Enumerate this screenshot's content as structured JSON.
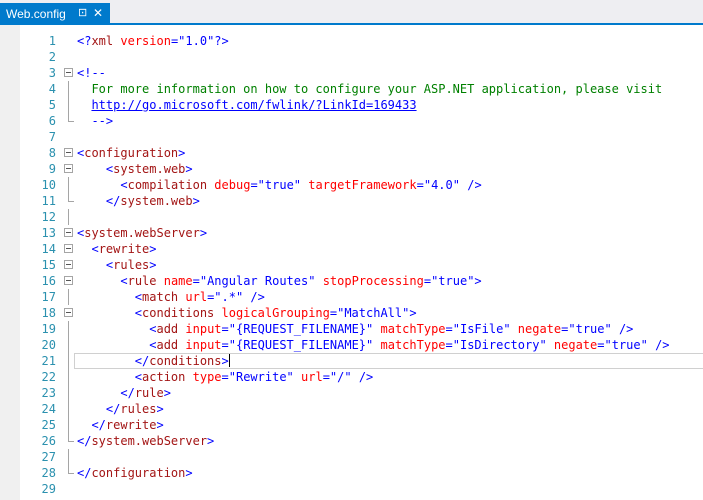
{
  "tab": {
    "title": "Web.config",
    "pin_glyph": "⊡",
    "close_glyph": "✕"
  },
  "editor": {
    "lines": [
      {
        "n": "1",
        "tokens": [
          [
            "b",
            "<?"
          ],
          [
            "t",
            "xml"
          ],
          [
            "a",
            " version"
          ],
          [
            "b",
            "=\""
          ],
          [
            "b",
            "1.0"
          ],
          [
            "b",
            "\"?>"
          ]
        ]
      },
      {
        "n": "2",
        "tokens": []
      },
      {
        "n": "3",
        "tokens": [
          [
            "b",
            "<!--"
          ]
        ]
      },
      {
        "n": "4",
        "tokens": [
          [
            "c",
            "  For more information on how to configure your ASP.NET application, please visit"
          ]
        ]
      },
      {
        "n": "5",
        "tokens": [
          [
            "c",
            "  "
          ],
          [
            "u",
            "http://go.microsoft.com/fwlink/?LinkId=169433"
          ]
        ]
      },
      {
        "n": "6",
        "tokens": [
          [
            "c",
            "  "
          ],
          [
            "b",
            "-->"
          ]
        ]
      },
      {
        "n": "7",
        "tokens": []
      },
      {
        "n": "8",
        "tokens": [
          [
            "b",
            "<"
          ],
          [
            "t",
            "configuration"
          ],
          [
            "b",
            ">"
          ]
        ]
      },
      {
        "n": "9",
        "tokens": [
          [
            "k",
            "    "
          ],
          [
            "b",
            "<"
          ],
          [
            "t",
            "system.web"
          ],
          [
            "b",
            ">"
          ]
        ]
      },
      {
        "n": "10",
        "tokens": [
          [
            "k",
            "      "
          ],
          [
            "b",
            "<"
          ],
          [
            "t",
            "compilation"
          ],
          [
            "a",
            " debug"
          ],
          [
            "b",
            "=\""
          ],
          [
            "b",
            "true"
          ],
          [
            "b",
            "\""
          ],
          [
            "a",
            " targetFramework"
          ],
          [
            "b",
            "=\""
          ],
          [
            "b",
            "4.0"
          ],
          [
            "b",
            "\""
          ],
          [
            "b",
            " />"
          ]
        ]
      },
      {
        "n": "11",
        "tokens": [
          [
            "k",
            "    "
          ],
          [
            "b",
            "</"
          ],
          [
            "t",
            "system.web"
          ],
          [
            "b",
            ">"
          ]
        ]
      },
      {
        "n": "12",
        "tokens": []
      },
      {
        "n": "13",
        "tokens": [
          [
            "b",
            "<"
          ],
          [
            "t",
            "system.webServer"
          ],
          [
            "b",
            ">"
          ]
        ]
      },
      {
        "n": "14",
        "tokens": [
          [
            "k",
            "  "
          ],
          [
            "b",
            "<"
          ],
          [
            "t",
            "rewrite"
          ],
          [
            "b",
            ">"
          ]
        ]
      },
      {
        "n": "15",
        "tokens": [
          [
            "k",
            "    "
          ],
          [
            "b",
            "<"
          ],
          [
            "t",
            "rules"
          ],
          [
            "b",
            ">"
          ]
        ]
      },
      {
        "n": "16",
        "tokens": [
          [
            "k",
            "      "
          ],
          [
            "b",
            "<"
          ],
          [
            "t",
            "rule"
          ],
          [
            "a",
            " name"
          ],
          [
            "b",
            "=\""
          ],
          [
            "b",
            "Angular Routes"
          ],
          [
            "b",
            "\""
          ],
          [
            "a",
            " stopProcessing"
          ],
          [
            "b",
            "=\""
          ],
          [
            "b",
            "true"
          ],
          [
            "b",
            "\">"
          ]
        ]
      },
      {
        "n": "17",
        "tokens": [
          [
            "k",
            "        "
          ],
          [
            "b",
            "<"
          ],
          [
            "t",
            "match"
          ],
          [
            "a",
            " url"
          ],
          [
            "b",
            "=\""
          ],
          [
            "b",
            ".*"
          ],
          [
            "b",
            "\""
          ],
          [
            "b",
            " />"
          ]
        ]
      },
      {
        "n": "18",
        "tokens": [
          [
            "k",
            "        "
          ],
          [
            "b",
            "<"
          ],
          [
            "t",
            "conditions"
          ],
          [
            "a",
            " logicalGrouping"
          ],
          [
            "b",
            "=\""
          ],
          [
            "b",
            "MatchAll"
          ],
          [
            "b",
            "\">"
          ]
        ]
      },
      {
        "n": "19",
        "tokens": [
          [
            "k",
            "          "
          ],
          [
            "b",
            "<"
          ],
          [
            "t",
            "add"
          ],
          [
            "a",
            " input"
          ],
          [
            "b",
            "=\""
          ],
          [
            "b",
            "{REQUEST_FILENAME}"
          ],
          [
            "b",
            "\""
          ],
          [
            "a",
            " matchType"
          ],
          [
            "b",
            "=\""
          ],
          [
            "b",
            "IsFile"
          ],
          [
            "b",
            "\""
          ],
          [
            "a",
            " negate"
          ],
          [
            "b",
            "=\""
          ],
          [
            "b",
            "true"
          ],
          [
            "b",
            "\""
          ],
          [
            "b",
            " />"
          ]
        ]
      },
      {
        "n": "20",
        "tokens": [
          [
            "k",
            "          "
          ],
          [
            "b",
            "<"
          ],
          [
            "t",
            "add"
          ],
          [
            "a",
            " input"
          ],
          [
            "b",
            "=\""
          ],
          [
            "b",
            "{REQUEST_FILENAME}"
          ],
          [
            "b",
            "\""
          ],
          [
            "a",
            " matchType"
          ],
          [
            "b",
            "=\""
          ],
          [
            "b",
            "IsDirectory"
          ],
          [
            "b",
            "\""
          ],
          [
            "a",
            " negate"
          ],
          [
            "b",
            "=\""
          ],
          [
            "b",
            "true"
          ],
          [
            "b",
            "\""
          ],
          [
            "b",
            " />"
          ]
        ]
      },
      {
        "n": "21",
        "tokens": [
          [
            "k",
            "        "
          ],
          [
            "b",
            "</"
          ],
          [
            "t",
            "conditions"
          ],
          [
            "b",
            ">"
          ]
        ]
      },
      {
        "n": "22",
        "tokens": [
          [
            "k",
            "        "
          ],
          [
            "b",
            "<"
          ],
          [
            "t",
            "action"
          ],
          [
            "a",
            " type"
          ],
          [
            "b",
            "=\""
          ],
          [
            "b",
            "Rewrite"
          ],
          [
            "b",
            "\""
          ],
          [
            "a",
            " url"
          ],
          [
            "b",
            "=\""
          ],
          [
            "b",
            "/"
          ],
          [
            "b",
            "\""
          ],
          [
            "b",
            " />"
          ]
        ]
      },
      {
        "n": "23",
        "tokens": [
          [
            "k",
            "      "
          ],
          [
            "b",
            "</"
          ],
          [
            "t",
            "rule"
          ],
          [
            "b",
            ">"
          ]
        ]
      },
      {
        "n": "24",
        "tokens": [
          [
            "k",
            "    "
          ],
          [
            "b",
            "</"
          ],
          [
            "t",
            "rules"
          ],
          [
            "b",
            ">"
          ]
        ]
      },
      {
        "n": "25",
        "tokens": [
          [
            "k",
            "  "
          ],
          [
            "b",
            "</"
          ],
          [
            "t",
            "rewrite"
          ],
          [
            "b",
            ">"
          ]
        ]
      },
      {
        "n": "26",
        "tokens": [
          [
            "b",
            "</"
          ],
          [
            "t",
            "system.webServer"
          ],
          [
            "b",
            ">"
          ]
        ]
      },
      {
        "n": "27",
        "tokens": []
      },
      {
        "n": "28",
        "tokens": [
          [
            "b",
            "</"
          ],
          [
            "t",
            "configuration"
          ],
          [
            "b",
            ">"
          ]
        ]
      },
      {
        "n": "29",
        "tokens": []
      }
    ]
  }
}
